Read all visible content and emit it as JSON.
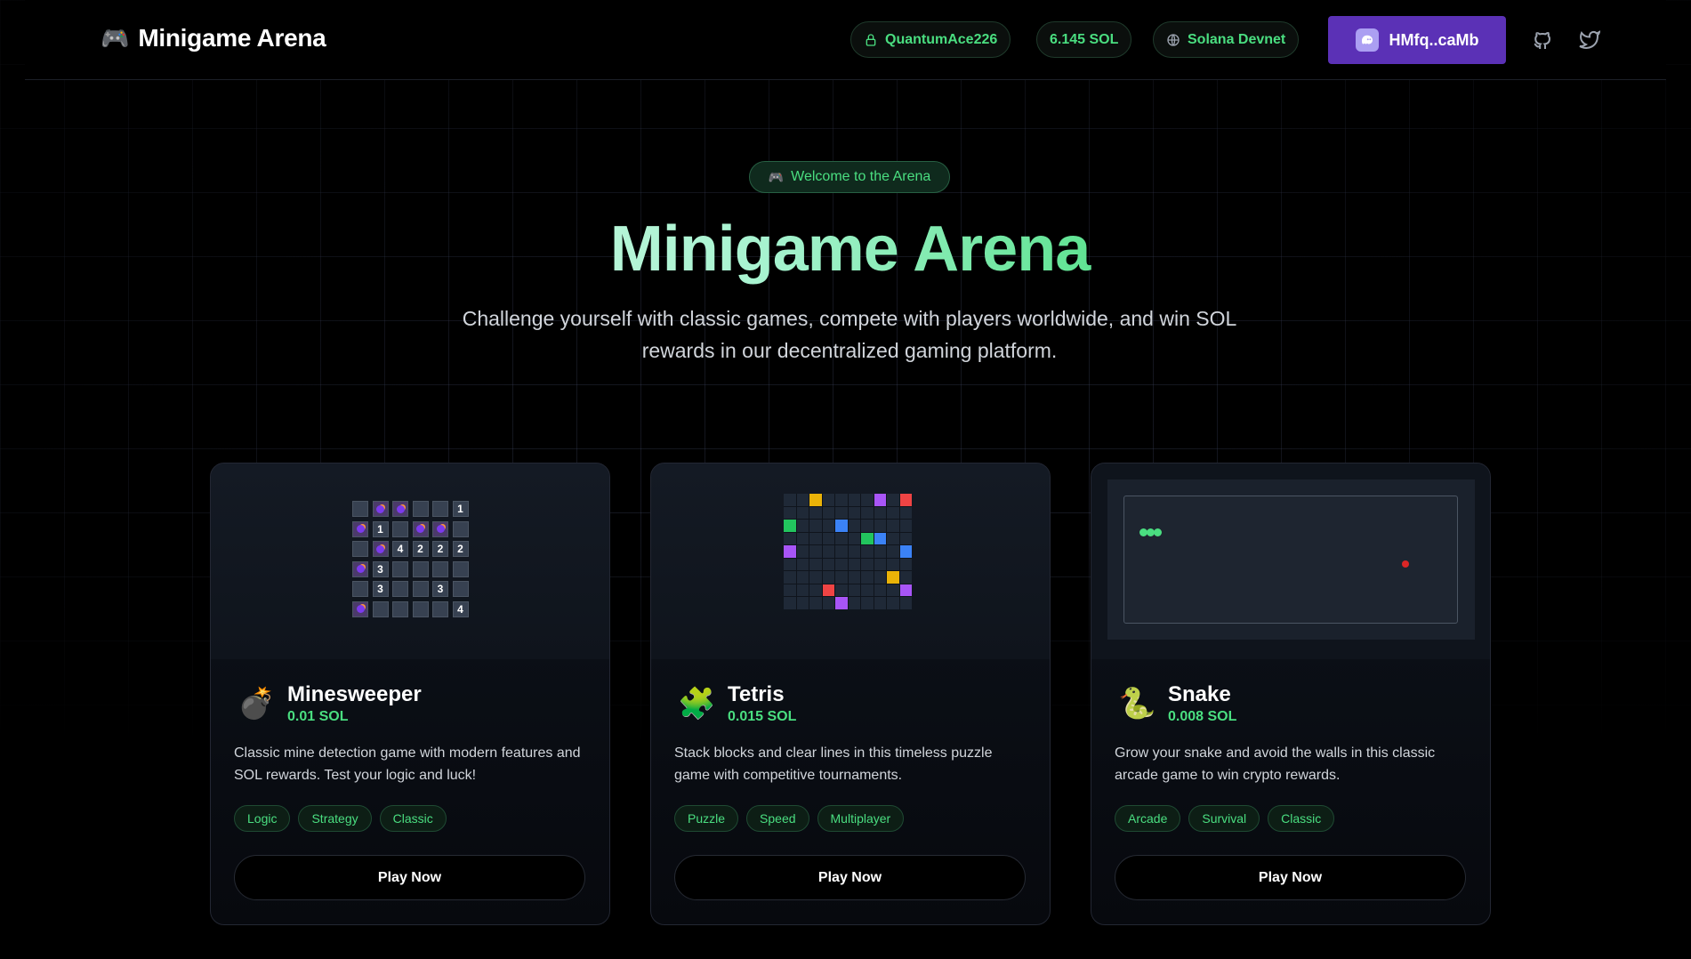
{
  "header": {
    "brand": "Minigame Arena",
    "username": "QuantumAce226",
    "balance": "6.145 SOL",
    "network": "Solana Devnet",
    "wallet": "HMfq..caMb"
  },
  "hero": {
    "badge": "Welcome to the Arena",
    "title": "Minigame Arena",
    "subtitle": "Challenge yourself with classic games, compete with players worldwide, and win SOL rewards in our decentralized gaming platform."
  },
  "games": [
    {
      "name": "Minesweeper",
      "price": "0.01 SOL",
      "description": "Classic mine detection game with modern features and SOL rewards. Test your logic and luck!",
      "tags": [
        "Logic",
        "Strategy",
        "Classic"
      ],
      "cta": "Play Now",
      "icon": "bomb-icon"
    },
    {
      "name": "Tetris",
      "price": "0.015 SOL",
      "description": "Stack blocks and clear lines in this timeless puzzle game with competitive tournaments.",
      "tags": [
        "Puzzle",
        "Speed",
        "Multiplayer"
      ],
      "cta": "Play Now",
      "icon": "puzzle-icon"
    },
    {
      "name": "Snake",
      "price": "0.008 SOL",
      "description": "Grow your snake and avoid the walls in this classic arcade game to win crypto rewards.",
      "tags": [
        "Arcade",
        "Survival",
        "Classic"
      ],
      "cta": "Play Now",
      "icon": "snake-icon"
    }
  ],
  "minesweeper_board": [
    [
      "",
      "m",
      "m",
      "",
      "",
      "1"
    ],
    [
      "m",
      "1",
      "",
      "m",
      "m",
      ""
    ],
    [
      "",
      "m",
      "4",
      "2",
      "2",
      "2"
    ],
    [
      "m",
      "3",
      "",
      "",
      "",
      ""
    ],
    [
      "",
      "3",
      "",
      "",
      "3",
      ""
    ],
    [
      "m",
      "",
      "",
      "",
      "",
      "4"
    ]
  ],
  "tetris_board": [
    "..y....p.rr",
    "..........g",
    "g...b......",
    "......gb..r",
    "p........b.",
    "..........",
    "........y.y",
    "...r.....p.",
    "....p.....",
    "...r....g.."
  ],
  "colors": {
    "accent_green": "#4ade80",
    "wallet_purple": "#5b31b6",
    "tetris_yellow": "#eab308",
    "tetris_purple": "#a855f7",
    "tetris_red": "#ef4444",
    "tetris_green": "#22c55e",
    "tetris_blue": "#3b82f6",
    "snake_green": "#4ade80",
    "food_red": "#dc2626"
  }
}
